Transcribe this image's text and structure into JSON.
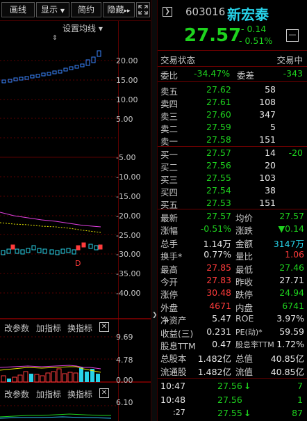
{
  "toolbar": {
    "tabs": [
      "画线",
      "显示",
      "简约",
      "隐藏"
    ],
    "display_arrow": "▼",
    "hide_arrow": "▸▸",
    "set_ma": "设置均线 ▾"
  },
  "chart": {
    "y_ticks": [
      "20.00",
      "15.00",
      "10.00",
      "5.00",
      "-5.00",
      "-10.00",
      "-15.00",
      "-20.00",
      "-25.00",
      "-30.00",
      "-35.00",
      "-40.00"
    ],
    "marker_d": "D",
    "colors": {
      "up": "#ff3b3b",
      "down": "#3a86ff",
      "ma1": "#e040e0",
      "ma2": "#e8e800"
    }
  },
  "indicator1": {
    "buttons": [
      "改参数",
      "加指标",
      "换指标"
    ],
    "close": "✕",
    "y_ticks": [
      "9.69",
      "4.78",
      "0.00"
    ]
  },
  "indicator2": {
    "buttons": [
      "改参数",
      "加指标",
      "换指标"
    ],
    "close": "✕",
    "y_ticks": [
      "6.10"
    ]
  },
  "quote": {
    "code": "603016",
    "name": "新宏泰",
    "price": "27.57",
    "change": "- 0.14",
    "change_pct": "- 0.51%",
    "minus_btn": "—",
    "status_label": "交易状态",
    "status_value": "交易中",
    "weibi_label": "委比",
    "weibi_value": "-34.47%",
    "weicha_label": "委差",
    "weicha_value": "-343",
    "asks": [
      {
        "label": "卖五",
        "price": "27.62",
        "vol": "58"
      },
      {
        "label": "卖四",
        "price": "27.61",
        "vol": "108"
      },
      {
        "label": "卖三",
        "price": "27.60",
        "vol": "347"
      },
      {
        "label": "卖二",
        "price": "27.59",
        "vol": "5"
      },
      {
        "label": "卖一",
        "price": "27.58",
        "vol": "151"
      }
    ],
    "bids": [
      {
        "label": "买一",
        "price": "27.57",
        "vol": "14",
        "extra": "-20"
      },
      {
        "label": "买二",
        "price": "27.56",
        "vol": "20",
        "extra": ""
      },
      {
        "label": "买三",
        "price": "27.55",
        "vol": "103",
        "extra": ""
      },
      {
        "label": "买四",
        "price": "27.54",
        "vol": "38",
        "extra": ""
      },
      {
        "label": "买五",
        "price": "27.53",
        "vol": "151",
        "extra": ""
      }
    ],
    "stats": [
      {
        "l1": "最新",
        "v1": "27.57",
        "c1": "green",
        "l2": "均价",
        "v2": "27.57",
        "c2": "green"
      },
      {
        "l1": "涨幅",
        "v1": "-0.51%",
        "c1": "green",
        "l2": "涨跌",
        "v2": "▼0.14",
        "c2": "green"
      },
      {
        "l1": "总手",
        "v1": "1.14万",
        "c1": "white",
        "l2": "金额",
        "v2": "3147万",
        "c2": "cyan"
      },
      {
        "l1": "换手*",
        "v1": "0.77%",
        "c1": "white",
        "l2": "量比",
        "v2": "1.06",
        "c2": "red"
      },
      {
        "l1": "最高",
        "v1": "27.85",
        "c1": "red",
        "l2": "最低",
        "v2": "27.46",
        "c2": "green"
      },
      {
        "l1": "今开",
        "v1": "27.83",
        "c1": "red",
        "l2": "昨收",
        "v2": "27.71",
        "c2": "white"
      },
      {
        "l1": "涨停",
        "v1": "30.48",
        "c1": "red",
        "l2": "跌停",
        "v2": "24.94",
        "c2": "green"
      },
      {
        "l1": "外盘",
        "v1": "4671",
        "c1": "red",
        "l2": "内盘",
        "v2": "6741",
        "c2": "green"
      },
      {
        "l1": "净资产",
        "v1": "5.47",
        "c1": "white",
        "l2": "ROE",
        "v2": "3.97%",
        "c2": "white"
      },
      {
        "l1": "收益(三)",
        "v1": "0.231",
        "c1": "white",
        "l2": "PE(动)*",
        "v2": "59.59",
        "c2": "white"
      },
      {
        "l1": "股息TTM",
        "v1": "0.47",
        "c1": "white",
        "l2": "股息率TTM",
        "v2": "1.72%",
        "c2": "white"
      },
      {
        "l1": "总股本",
        "v1": "1.482亿",
        "c1": "white",
        "l2": "总值",
        "v2": "40.85亿",
        "c2": "white"
      },
      {
        "l1": "流通股",
        "v1": "1.482亿",
        "c1": "white",
        "l2": "流值",
        "v2": "40.85亿",
        "c2": "white"
      }
    ],
    "ticks": [
      {
        "time": "10:47",
        "price": "27.56",
        "arrow": "↓",
        "vol": "7"
      },
      {
        "time": "10:48",
        "price": "27.56",
        "arrow": "",
        "vol": "1"
      },
      {
        "time": ":27",
        "price": "27.55",
        "arrow": "↓",
        "vol": "87"
      }
    ]
  }
}
